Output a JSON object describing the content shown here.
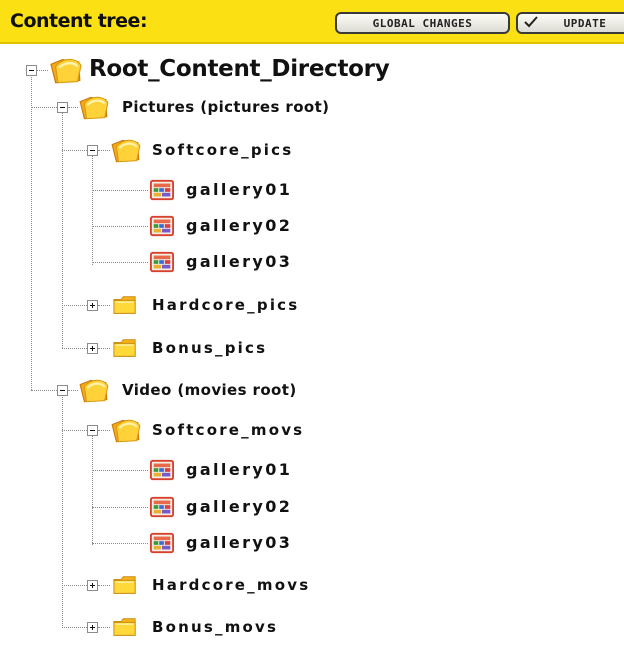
{
  "header": {
    "title": "Content tree:",
    "global_changes_label": "GLOBAL CHANGES",
    "update_label": "UPDATE"
  },
  "tree": {
    "root": {
      "label": "Root_Content_Directory",
      "children": [
        {
          "label": "Pictures (pictures root)",
          "children": [
            {
              "label": "Softcore_pics",
              "expanded": true,
              "children": [
                {
                  "label": "gallery01"
                },
                {
                  "label": "gallery02"
                },
                {
                  "label": "gallery03"
                }
              ]
            },
            {
              "label": "Hardcore_pics",
              "expanded": false
            },
            {
              "label": "Bonus_pics",
              "expanded": false
            }
          ]
        },
        {
          "label": "Video (movies root)",
          "children": [
            {
              "label": "Softcore_movs",
              "expanded": true,
              "children": [
                {
                  "label": "gallery01"
                },
                {
                  "label": "gallery02"
                },
                {
                  "label": "gallery03"
                }
              ]
            },
            {
              "label": "Hardcore_movs",
              "expanded": false
            },
            {
              "label": "Bonus_movs",
              "expanded": false
            }
          ]
        }
      ]
    }
  },
  "icons": {
    "open_folder": "open-folder-icon",
    "closed_folder": "folder-icon",
    "gallery": "gallery-icon",
    "expanded": "minus-box-icon",
    "collapsed": "plus-box-icon",
    "check": "check-icon"
  },
  "colors": {
    "header_bg": "#fbe114",
    "folder_yellow": "#ffd23a",
    "folder_orange": "#f5a81c",
    "gallery_red": "#d8402a"
  }
}
